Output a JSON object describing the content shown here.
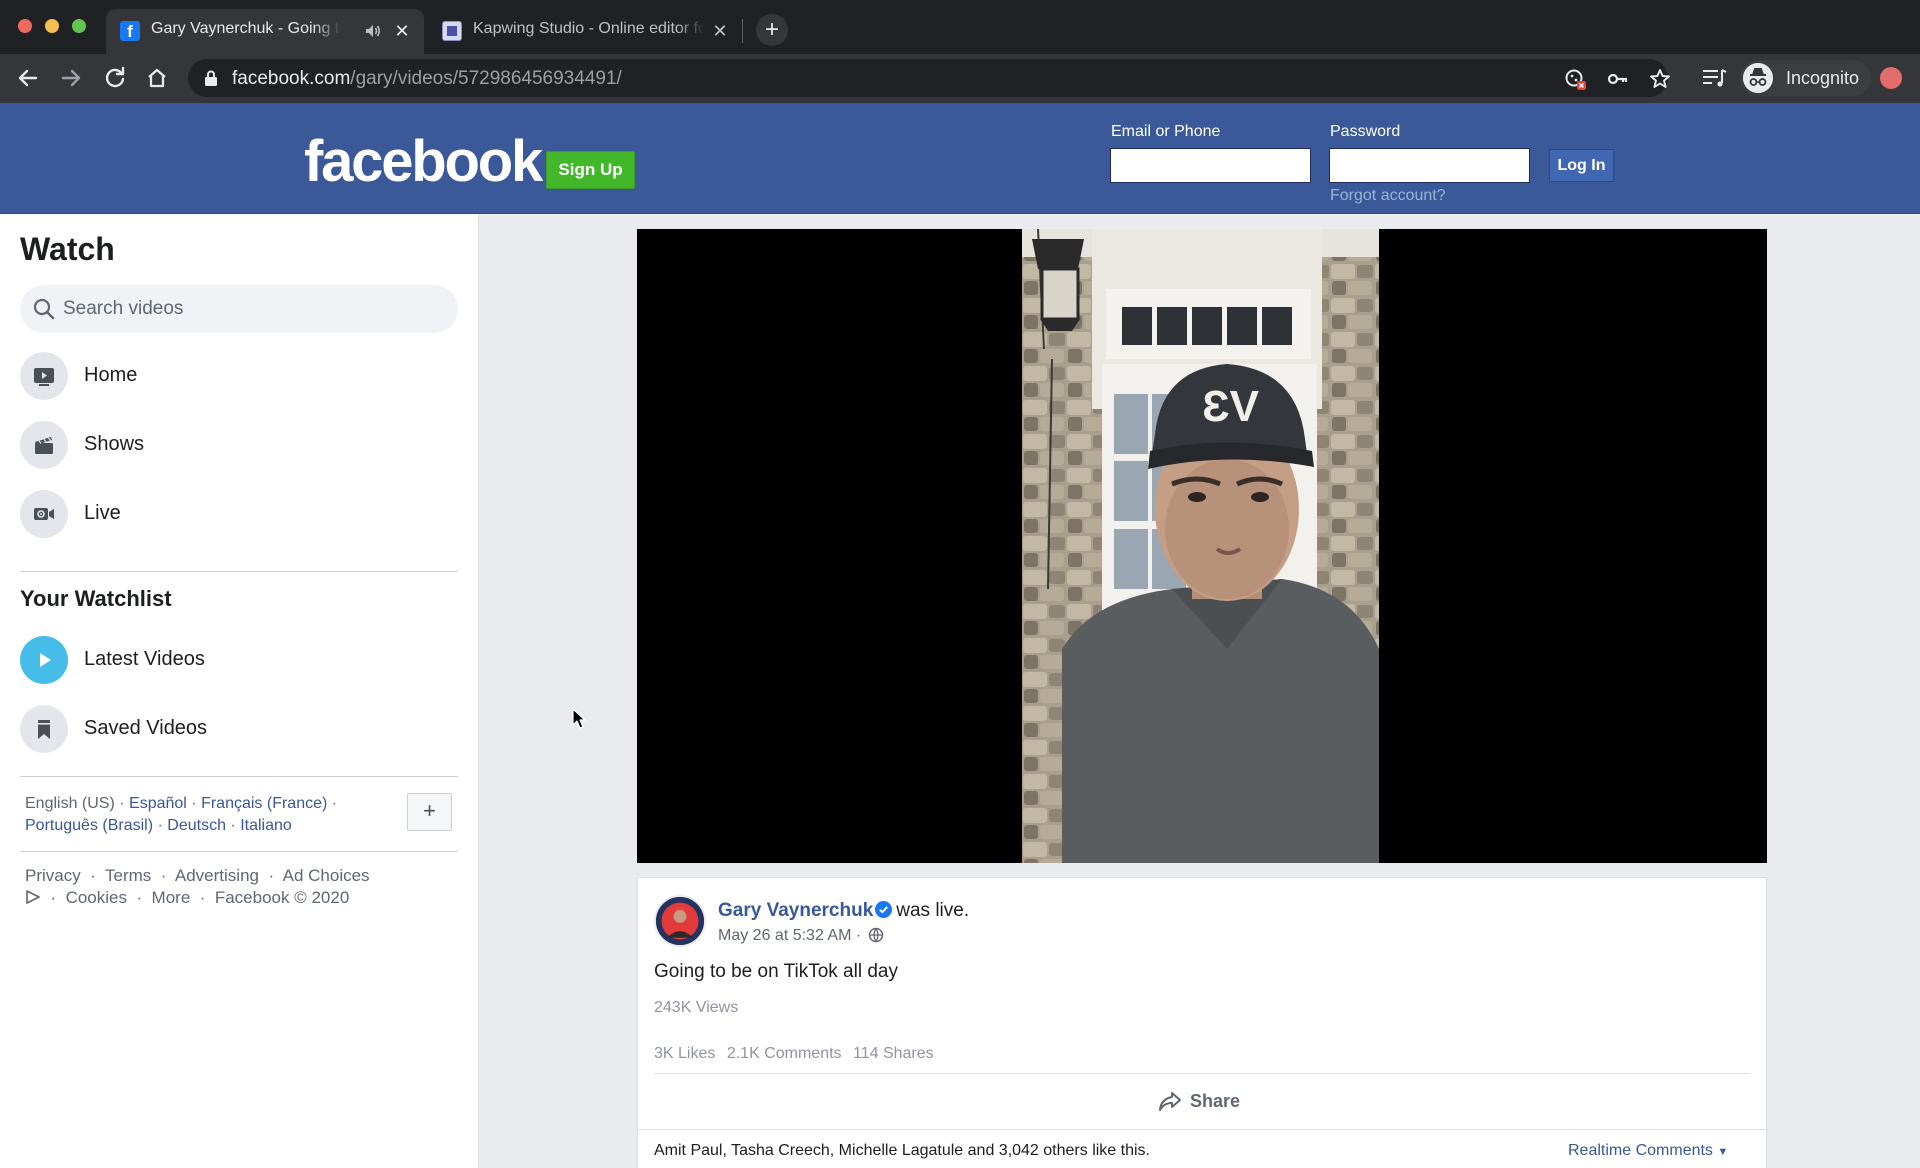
{
  "browser": {
    "tabs": [
      {
        "title": "Gary Vaynerchuk - Going to be on TikTok all day",
        "active": true,
        "favicon": "facebook-icon",
        "audio": true
      },
      {
        "title": "Kapwing Studio - Online editor for videos",
        "active": false,
        "favicon": "kapwing-icon"
      }
    ],
    "url_host": "facebook.com",
    "url_path": "/gary/videos/572986456934491/",
    "profile_label": "Incognito"
  },
  "header": {
    "logo": "facebook",
    "signup_label": "Sign Up",
    "email_label": "Email or Phone",
    "password_label": "Password",
    "login_label": "Log In",
    "forgot_label": "Forgot account?"
  },
  "sidebar": {
    "title": "Watch",
    "search_placeholder": "Search videos",
    "nav": [
      {
        "label": "Home",
        "icon": "video-home-icon"
      },
      {
        "label": "Shows",
        "icon": "clapperboard-icon"
      },
      {
        "label": "Live",
        "icon": "live-camera-icon"
      }
    ],
    "watchlist_title": "Your Watchlist",
    "watchlist": [
      {
        "label": "Latest Videos",
        "icon": "play-icon"
      },
      {
        "label": "Saved Videos",
        "icon": "bookmark-icon"
      }
    ],
    "languages": {
      "current": "English (US)",
      "links": [
        "Español",
        "Français (France)",
        "Português (Brasil)",
        "Deutsch",
        "Italiano"
      ]
    },
    "footer": {
      "privacy": "Privacy",
      "terms": "Terms",
      "advertising": "Advertising",
      "ad_choices": "Ad Choices",
      "cookies": "Cookies",
      "more": "More",
      "copyright": "Facebook © 2020"
    }
  },
  "post": {
    "author": "Gary Vaynerchuk",
    "action": "was live.",
    "timestamp": "May 26 at 5:32 AM",
    "text": "Going to be on TikTok all day",
    "views": "243K Views",
    "likes": "3K Likes",
    "comments": "2.1K Comments",
    "shares": "114 Shares",
    "share_label": "Share",
    "likes_line": "Amit Paul, Tasha Creech, Michelle Lagatule and 3,042 others like this.",
    "realtime_label": "Realtime Comments"
  },
  "colors": {
    "facebook_blue": "#3b5998",
    "signup_green": "#42b72a",
    "link_blue": "#385898",
    "watch_accent": "#45bde8"
  }
}
